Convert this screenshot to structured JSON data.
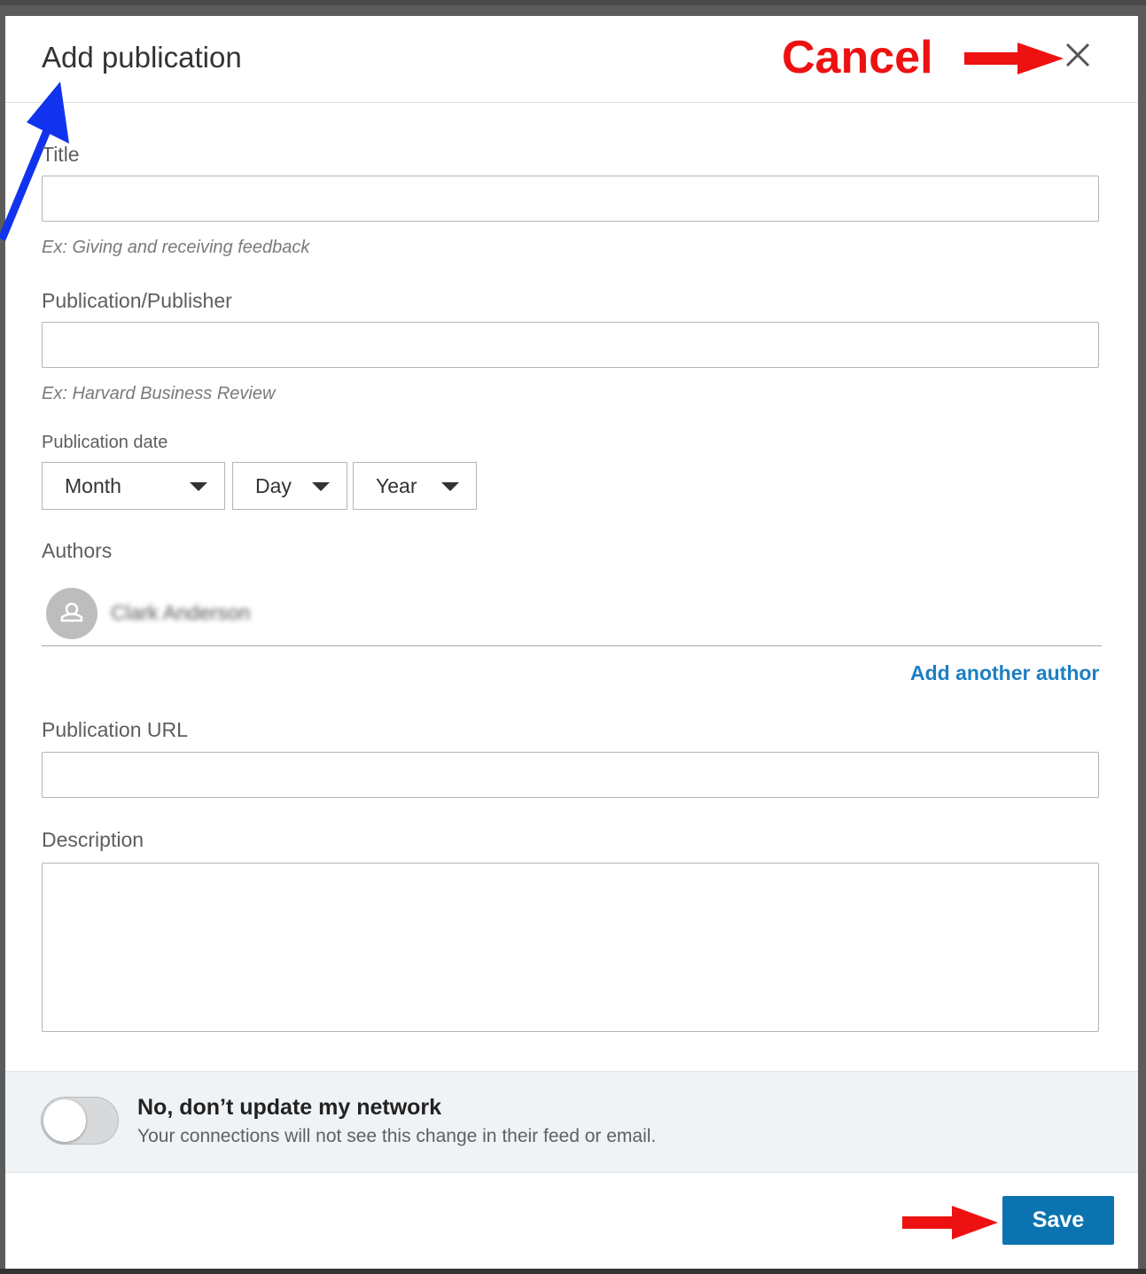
{
  "dialog": {
    "title": "Add publication",
    "close_icon": "close-icon"
  },
  "annotations": {
    "cancel_label": "Cancel",
    "arrow_color": "#ee1111",
    "pointer_color": "#1133ee"
  },
  "form": {
    "title_label": "Title",
    "title_value": "",
    "title_hint": "Ex: Giving and receiving feedback",
    "publisher_label": "Publication/Publisher",
    "publisher_value": "",
    "publisher_hint": "Ex: Harvard Business Review",
    "date_label": "Publication date",
    "date_selects": {
      "month": "Month",
      "day": "Day",
      "year": "Year"
    },
    "authors_label": "Authors",
    "authors": [
      {
        "name": "Clark Anderson",
        "avatar_icon": "person-icon"
      }
    ],
    "add_author_link": "Add another author",
    "url_label": "Publication URL",
    "url_value": "",
    "description_label": "Description",
    "description_value": ""
  },
  "network_toggle": {
    "state": "off",
    "title": "No, don’t update my network",
    "subtitle": "Your connections will not see this change in their feed or email."
  },
  "actions": {
    "save_label": "Save",
    "save_color": "#0b73b0"
  }
}
